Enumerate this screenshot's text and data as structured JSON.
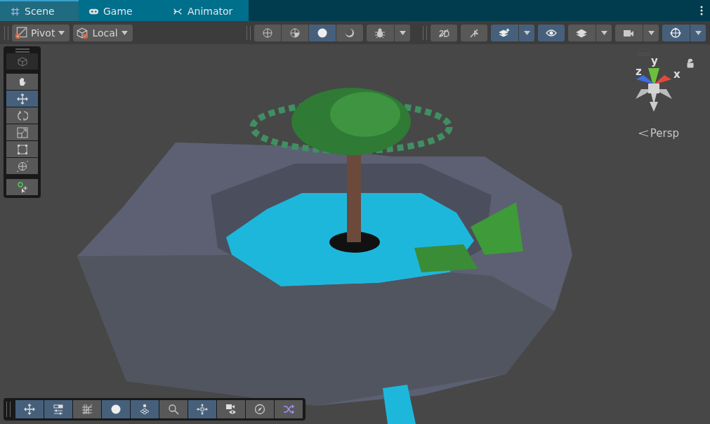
{
  "tabs": [
    {
      "label": "Scene",
      "kind": "grid",
      "selected": true
    },
    {
      "label": "Game",
      "kind": "gamepad",
      "selected": false
    },
    {
      "label": "Animator",
      "kind": "animator",
      "selected": false
    }
  ],
  "toolbar": {
    "handle_dropdowns": [
      {
        "label": "Pivot",
        "kind": "pivot"
      },
      {
        "label": "Local",
        "kind": "local"
      }
    ],
    "view_groups": [
      {
        "buttons": [
          {
            "kind": "globe",
            "selected": false,
            "dropdown": false
          },
          {
            "kind": "half-globe",
            "selected": false,
            "dropdown": false
          },
          {
            "kind": "disc",
            "selected": true,
            "dropdown": false
          },
          {
            "kind": "crescent",
            "selected": false,
            "dropdown": false
          }
        ]
      },
      {
        "buttons": [
          {
            "kind": "bug",
            "selected": false,
            "dropdown": true
          }
        ]
      }
    ],
    "toggle_groups": [
      {
        "buttons": [
          {
            "kind": "dimension",
            "selected": false,
            "dropdown": false
          }
        ]
      },
      {
        "buttons": [
          {
            "kind": "muted-speaker",
            "selected": false,
            "dropdown": false
          }
        ]
      },
      {
        "buttons": [
          {
            "kind": "sparkle-stack",
            "selected": true,
            "dropdown": true
          }
        ]
      },
      {
        "buttons": [
          {
            "kind": "eye",
            "selected": true,
            "dropdown": false
          }
        ]
      },
      {
        "buttons": [
          {
            "kind": "layers",
            "selected": false,
            "dropdown": true
          }
        ]
      },
      {
        "buttons": [
          {
            "kind": "camera",
            "selected": false,
            "dropdown": true
          }
        ]
      },
      {
        "buttons": [
          {
            "kind": "orbit",
            "selected": true,
            "dropdown": true
          }
        ]
      }
    ]
  },
  "tools": [
    {
      "kind": "cube",
      "selected": false,
      "disabled": true
    },
    {
      "kind": "hand",
      "selected": false,
      "disabled": false
    },
    {
      "kind": "move",
      "selected": true,
      "disabled": false
    },
    {
      "kind": "rotate",
      "selected": false,
      "disabled": false
    },
    {
      "kind": "scale",
      "selected": false,
      "disabled": false
    },
    {
      "kind": "rect",
      "selected": false,
      "disabled": false
    },
    {
      "kind": "transform",
      "selected": false,
      "disabled": false
    }
  ],
  "custom_tools": [
    {
      "kind": "add-point",
      "selected": false,
      "disabled": false
    }
  ],
  "gizmo": {
    "axes": [
      "y",
      "z",
      "x"
    ],
    "projection": "Persp"
  },
  "overlay_bar": [
    {
      "kind": "move",
      "selected": true
    },
    {
      "kind": "sliders",
      "selected": true
    },
    {
      "kind": "grid-slash",
      "selected": false
    },
    {
      "kind": "disc",
      "selected": true
    },
    {
      "kind": "dot-grid",
      "selected": true
    },
    {
      "kind": "search",
      "selected": false
    },
    {
      "kind": "nodes",
      "selected": true
    },
    {
      "kind": "camera-eye",
      "selected": false
    },
    {
      "kind": "compass",
      "selected": false
    },
    {
      "kind": "shuffle",
      "selected": false
    }
  ]
}
